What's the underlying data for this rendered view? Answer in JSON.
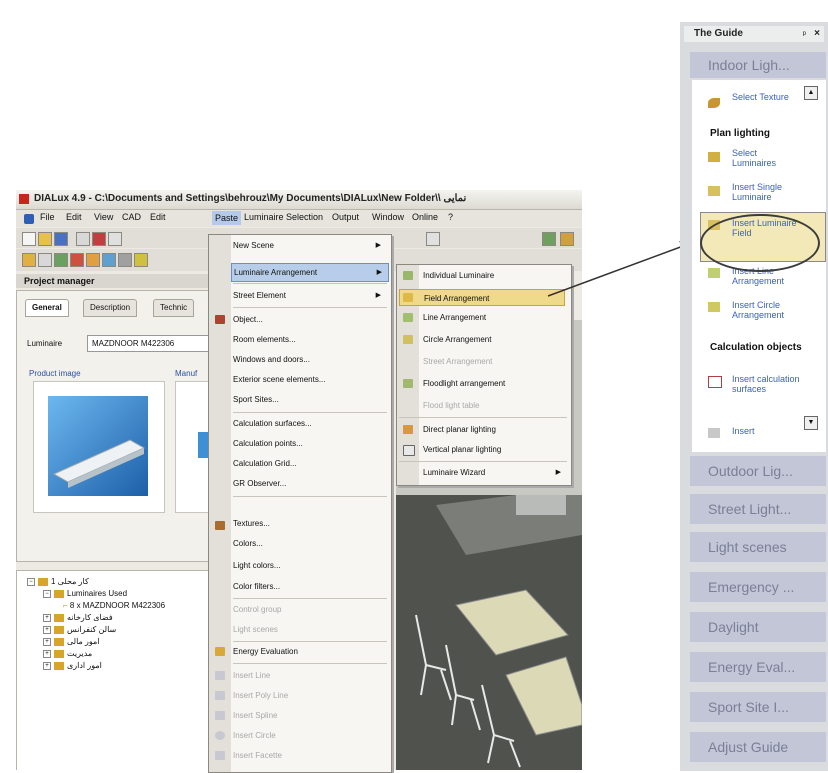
{
  "window": {
    "title": "DIALux 4.9 - C:\\Documents and Settings\\behrouz\\My Documents\\DIALux\\New Folder\\\\ نمایی",
    "menu": [
      "File",
      "Edit",
      "View",
      "CAD",
      "Edit",
      "Paste",
      "Luminaire Selection",
      "Output",
      "Window",
      "Online",
      "?"
    ]
  },
  "project_manager": {
    "header": "Project manager",
    "tabs": [
      "General",
      "Description",
      "Technic"
    ],
    "luminaire_label": "Luminaire",
    "luminaire_value": "MAZDNOOR M422306",
    "product_image_label": "Product image",
    "manufacturer_label": "Manuf"
  },
  "tree": [
    "کار محلی 1",
    "Luminaires Used",
    "8 x MAZDNOOR M422306",
    "فضای کارخانه",
    "سالن کنفرانس",
    "امور مالی",
    "مدیریت",
    "امور اداری"
  ],
  "paste_menu": [
    {
      "label": "New Scene",
      "arrow": true,
      "state": "normal"
    },
    {
      "label": "Luminaire Arrangement",
      "arrow": true,
      "state": "highlighted"
    },
    {
      "label": "Street Element",
      "arrow": true,
      "state": "normal"
    },
    {
      "label": "Object...",
      "state": "normal"
    },
    {
      "label": "Room elements...",
      "state": "normal"
    },
    {
      "label": "Windows and doors...",
      "state": "normal"
    },
    {
      "label": "Exterior scene elements...",
      "state": "normal"
    },
    {
      "label": "Sport Sites...",
      "state": "normal"
    },
    {
      "label": "Calculation surfaces...",
      "state": "normal"
    },
    {
      "label": "Calculation points...",
      "state": "normal"
    },
    {
      "label": "Calculation Grid...",
      "state": "normal"
    },
    {
      "label": "GR Observer...",
      "state": "normal"
    },
    {
      "label": "Textures...",
      "state": "normal"
    },
    {
      "label": "Colors...",
      "state": "normal"
    },
    {
      "label": "Light colors...",
      "state": "normal"
    },
    {
      "label": "Color filters...",
      "state": "normal"
    },
    {
      "label": "Control group",
      "state": "disabled"
    },
    {
      "label": "Light scenes",
      "state": "disabled"
    },
    {
      "label": "Energy Evaluation",
      "state": "normal"
    },
    {
      "label": "Insert Line",
      "state": "disabled"
    },
    {
      "label": "Insert Poly Line",
      "state": "disabled"
    },
    {
      "label": "Insert Spline",
      "state": "disabled"
    },
    {
      "label": "Insert Circle",
      "state": "disabled"
    },
    {
      "label": "Insert Facette",
      "state": "disabled"
    }
  ],
  "luminaire_submenu": [
    {
      "label": "Individual Luminaire",
      "state": "normal"
    },
    {
      "label": "Field Arrangement",
      "state": "highlighted"
    },
    {
      "label": "Line Arrangement",
      "state": "normal"
    },
    {
      "label": "Circle Arrangement",
      "state": "normal"
    },
    {
      "label": "Street Arrangement",
      "state": "disabled"
    },
    {
      "label": "Floodlight arrangement",
      "state": "normal"
    },
    {
      "label": "Flood light table",
      "state": "disabled"
    },
    {
      "label": "Direct planar lighting",
      "state": "normal"
    },
    {
      "label": "Vertical planar lighting",
      "state": "normal"
    },
    {
      "label": "Luminaire Wizard",
      "arrow": true,
      "state": "normal"
    }
  ],
  "guide": {
    "title": "The Guide",
    "pin": "ᵖ",
    "close": "×",
    "active_section": "Indoor Ligh...",
    "items": [
      {
        "type": "link",
        "label": "Select Texture",
        "icon": "brush-icon"
      },
      {
        "type": "heading",
        "label": "Plan lighting"
      },
      {
        "type": "link",
        "label": "Select Luminaires",
        "icon": "luminaire-select-icon"
      },
      {
        "type": "link",
        "label": "Insert Single Luminaire",
        "icon": "single-luminaire-icon"
      },
      {
        "type": "link",
        "label": "Insert Luminaire Field",
        "icon": "luminaire-field-icon",
        "highlighted": true
      },
      {
        "type": "link",
        "label": "Insert Line Arrangement",
        "icon": "line-arrangement-icon"
      },
      {
        "type": "link",
        "label": "Insert Circle Arrangement",
        "icon": "circle-arrangement-icon"
      },
      {
        "type": "heading",
        "label": "Calculation objects"
      },
      {
        "type": "link",
        "label": "Insert calculation surfaces",
        "icon": "calc-surface-icon"
      },
      {
        "type": "link",
        "label": "Insert",
        "icon": "calc-point-icon"
      }
    ],
    "sections": [
      "Outdoor Lig...",
      "Street Light...",
      "Light scenes",
      "Emergency ...",
      "Daylight",
      "Energy Eval...",
      "Sport Site I...",
      "Adjust Guide"
    ]
  },
  "colors": {
    "menu_highlight": "#b7cde9",
    "submenu_highlight": "#efd98a",
    "guide_link": "#3a5fc0",
    "guide_section": "#c3c6d6"
  }
}
